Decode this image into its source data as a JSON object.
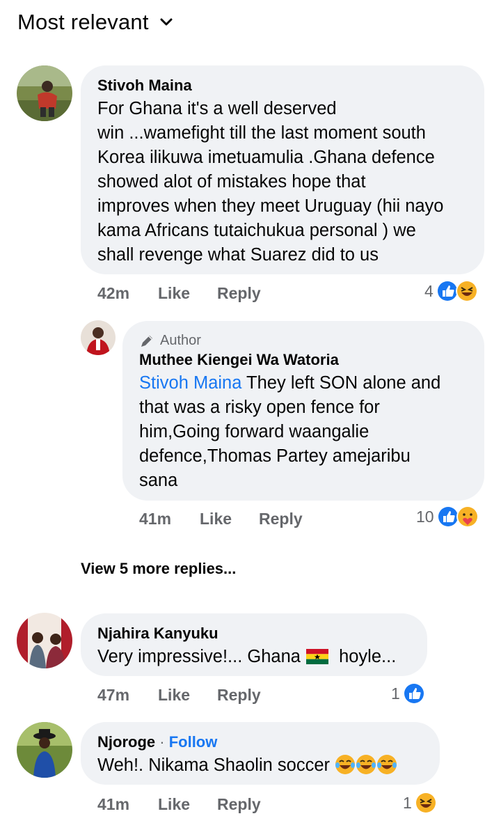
{
  "header": {
    "sort_label": "Most relevant"
  },
  "comments": [
    {
      "name": "Stivoh Maina",
      "lines": [
        "For Ghana it's a well deserved",
        "win ...wamefight till the last moment south",
        "Korea ilikuwa imetuamulia .Ghana defence",
        "showed alot of mistakes hope that",
        "improves when they meet Uruguay (hii nayo",
        "kama Africans tutaichukua personal ) we",
        "shall revenge what Suarez did to us"
      ],
      "time": "42m",
      "like": "Like",
      "reply": "Reply",
      "reaction_count": "4",
      "reactions": [
        "like-icon",
        "laugh-icon"
      ]
    },
    {
      "author_tag": "Author",
      "name": "Muthee Kiengei Wa Watoria",
      "mention": "Stivoh Maina",
      "lines": [
        "They left SON alone and",
        "that was a risky open fence for",
        "him,Going forward waangalie",
        "defence,Thomas Partey amejaribu",
        "sana"
      ],
      "time": "41m",
      "like": "Like",
      "reply": "Reply",
      "reaction_count": "10",
      "reactions": [
        "like-icon",
        "care-icon"
      ]
    },
    {
      "name": "Njahira Kanyuku",
      "text_before": "Very impressive!... Ghana",
      "text_after": "hoyle...",
      "time": "47m",
      "like": "Like",
      "reply": "Reply",
      "reaction_count": "1",
      "reactions": [
        "like-icon"
      ]
    },
    {
      "name": "Njoroge",
      "separator": "·",
      "follow": "Follow",
      "text": "Weh!. Nikama Shaolin soccer",
      "time": "41m",
      "like": "Like",
      "reply": "Reply",
      "reaction_count": "1",
      "reactions": [
        "laugh-icon"
      ]
    }
  ],
  "view_more": "View 5 more replies...",
  "colors": {
    "link": "#1877f2",
    "bubble": "#f0f2f5",
    "muted": "#65676b"
  }
}
